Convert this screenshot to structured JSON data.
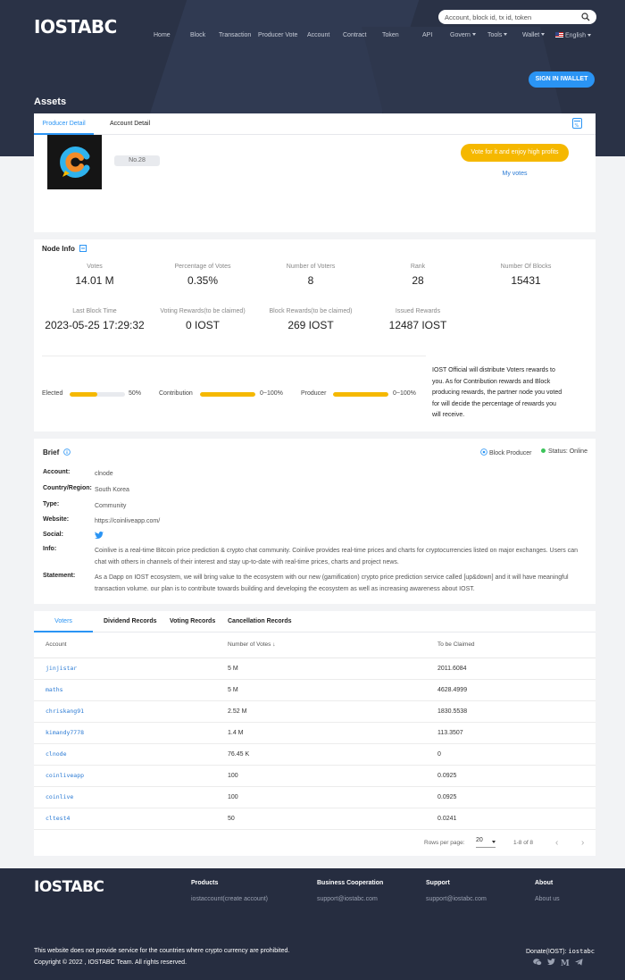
{
  "header": {
    "logo": "IOSTABC",
    "search_placeholder": "Account, block id, tx id, token",
    "nav": [
      "Home",
      "Block",
      "Transaction",
      "Producer Vote",
      "Account",
      "Contract",
      "Token",
      "API"
    ],
    "nav_dropdowns": [
      "Govern",
      "Tools",
      "Wallet"
    ],
    "language": "English",
    "signin": "SIGN IN IWALLET",
    "page_title": "Assets"
  },
  "producer": {
    "tabs": [
      "Producer Detail",
      "Account Detail"
    ],
    "rank_badge": "No.28",
    "vote_button": "Vote for it and enjoy high profits",
    "my_votes": "My votes"
  },
  "node_info": {
    "title": "Node Info",
    "stats": [
      {
        "label": "Votes",
        "value": "14.01 M"
      },
      {
        "label": "Percentage of Votes",
        "value": "0.35%"
      },
      {
        "label": "Number of Voters",
        "value": "8"
      },
      {
        "label": "Rank",
        "value": "28"
      },
      {
        "label": "Number Of Blocks",
        "value": "15431"
      },
      {
        "label": "Last Block Time",
        "value": "2023-05-25 17:29:32"
      },
      {
        "label": "Voting Rewards(to be claimed)",
        "value": "0 IOST"
      },
      {
        "label": "Block Rewards(to be claimed)",
        "value": "269 IOST"
      },
      {
        "label": "Issued Rewards",
        "value": "12487 IOST"
      }
    ],
    "bars": [
      {
        "label": "Elected",
        "value_text": "50%",
        "fraction": 0.5
      },
      {
        "label": "Contribution",
        "value_text": "0~100%",
        "fraction": 1.0
      },
      {
        "label": "Producer",
        "value_text": "0~100%",
        "fraction": 1.0
      }
    ],
    "note": "IOST Official will distribute Voters rewards to you. As for Contribution rewards and Block producing rewards, the partner node you voted for will decide the percentage of rewards you will receive."
  },
  "brief": {
    "title": "Brief",
    "role": "Block Producer",
    "status": "Status: Online",
    "rows": [
      {
        "key": "Account:",
        "value": "clnode"
      },
      {
        "key": "Country/Region:",
        "value": "South Korea"
      },
      {
        "key": "Type:",
        "value": "Community"
      },
      {
        "key": "Website:",
        "value": "https://coinliveapp.com/"
      },
      {
        "key": "Social:",
        "value": ""
      },
      {
        "key": "Info:",
        "value": "Coinlive is a real-time Bitcoin price prediction & crypto chat community. Coinlive provides real-time prices and charts for cryptocurrencies listed on major exchanges. Users can chat with others in channels of their interest and stay up-to-date with real-time prices, charts and project news."
      },
      {
        "key": "Statement:",
        "value": "As a Dapp on IOST ecosystem, we will bring value to the ecosystem with our new (gamification) crypto price prediction service called [up&down] and it will have meaningful transaction volume. our plan is to contribute towards building and developing the ecosystem as well as increasing awareness about IOST."
      }
    ]
  },
  "voters": {
    "tabs": [
      "Voters",
      "Dividend Records",
      "Voting Records",
      "Cancellation Records"
    ],
    "columns": [
      "Account",
      "Number of Votes",
      "To be Claimed"
    ],
    "rows": [
      [
        "jinjistar",
        "5 M",
        "2011.6084"
      ],
      [
        "maths",
        "5 M",
        "4628.4999"
      ],
      [
        "chriskang91",
        "2.52 M",
        "1830.5538"
      ],
      [
        "kimandy7778",
        "1.4 M",
        "113.3507"
      ],
      [
        "clnode",
        "76.45 K",
        "0"
      ],
      [
        "coinliveapp",
        "100",
        "0.0925"
      ],
      [
        "coinlive",
        "100",
        "0.0925"
      ],
      [
        "cltest4",
        "50",
        "0.0241"
      ]
    ],
    "rows_per_page_label": "Rows per page:",
    "rows_per_page": "20",
    "range": "1-8 of 8"
  },
  "footer": {
    "logo": "IOSTABC",
    "cols": [
      {
        "heading": "Products",
        "item": "iostaccount(create account)"
      },
      {
        "heading": "Business Cooperation",
        "item": "support@iostabc.com"
      },
      {
        "heading": "Support",
        "item": "support@iostabc.com"
      },
      {
        "heading": "About",
        "item": "About us"
      }
    ],
    "disclaimer": "This website does not provide service for the countries where crypto currency are prohibited.",
    "copyright": "Copyright © 2022 , IOSTABC Team. All rights reserved.",
    "donate_label": "Donate(IOST):",
    "donate_account": "iostabc"
  },
  "colors": {
    "accent": "#2a94f4",
    "vote": "#f5b800",
    "hero": "#2a3246",
    "footer": "#262d40"
  }
}
